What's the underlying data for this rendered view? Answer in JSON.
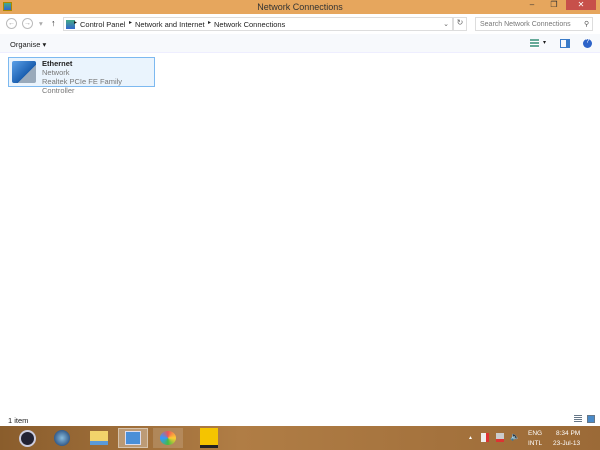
{
  "window": {
    "title": "Network Connections",
    "minimize": "–",
    "restore": "❐",
    "close": "✕"
  },
  "nav": {
    "back": "←",
    "forward": "→",
    "dropdown": "▾",
    "up": "↑",
    "breadcrumb": [
      "Control Panel",
      "Network and Internet",
      "Network Connections"
    ],
    "refresh": "↻",
    "search_placeholder": "Search Network Connections"
  },
  "toolbar": {
    "organise": "Organise"
  },
  "items": [
    {
      "name": "Ethernet",
      "status": "Network",
      "device": "Realtek PCIe FE Family Controller"
    }
  ],
  "status": {
    "count": "1 item"
  },
  "tray": {
    "lang1": "ENG",
    "lang2": "INTL",
    "time": "8:34 PM",
    "date": "23-Jul-13"
  }
}
